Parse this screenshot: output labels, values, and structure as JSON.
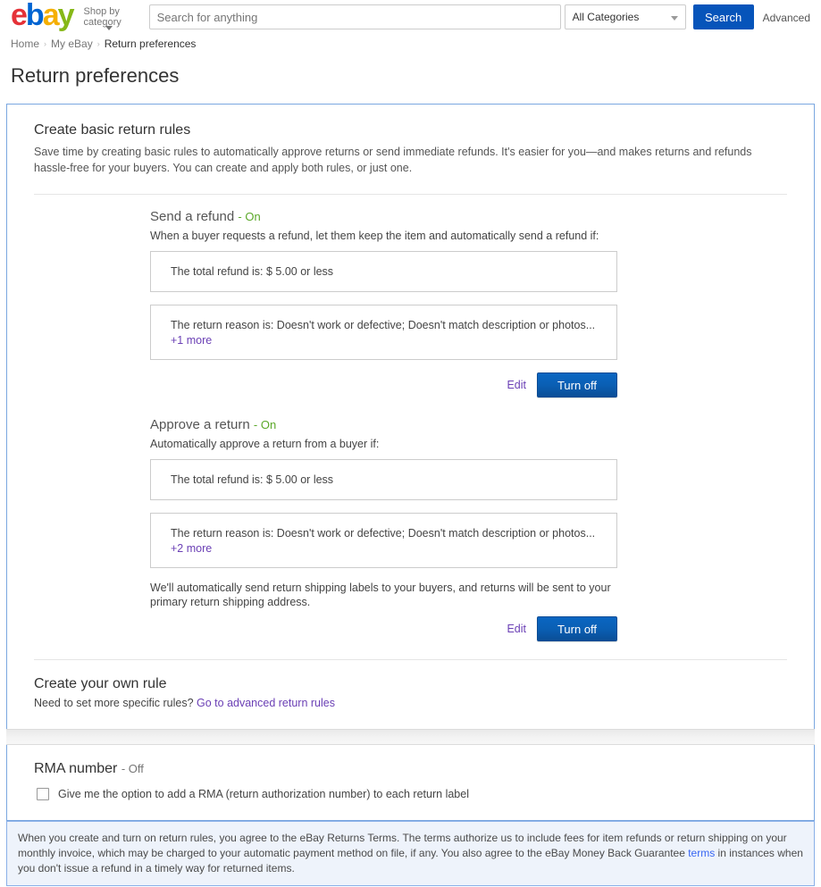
{
  "header": {
    "logo": {
      "e": "e",
      "b": "b",
      "a": "a",
      "y": "y",
      "alt": "ebay"
    },
    "shop_by_category": "Shop by category",
    "search_placeholder": "Search for anything",
    "search_value": "",
    "category_selected": "All Categories",
    "search_button": "Search",
    "advanced_link": "Advanced",
    "accent_blue": "#0654ba"
  },
  "breadcrumb": {
    "home": "Home",
    "my_ebay": "My eBay",
    "current": "Return preferences",
    "separator": "›"
  },
  "page_title": "Return preferences",
  "basic_rules": {
    "title": "Create basic return rules",
    "description": "Save time by creating basic rules to automatically approve returns or send immediate refunds. It's easier for you—and makes returns and refunds hassle-free for your buyers. You can create and apply both rules, or just one.",
    "rules": [
      {
        "name": "Send a refund",
        "state_prefix": "-",
        "state": "On",
        "state_color": "#5ba829",
        "subtitle": "When a buyer requests a refund, let them keep the item and automatically send a refund if:",
        "condition_amount": "The total refund is: $ 5.00 or less",
        "condition_reason_prefix": "The return reason is:  Doesn't work or defective; Doesn't match description or photos...",
        "condition_reason_more": "+1 more",
        "note": "",
        "edit_label": "Edit",
        "toggle_label": "Turn off"
      },
      {
        "name": "Approve a return",
        "state_prefix": "-",
        "state": "On",
        "state_color": "#5ba829",
        "subtitle": "Automatically approve a return from a buyer if:",
        "condition_amount": "The total refund is: $ 5.00 or less",
        "condition_reason_prefix": "The return reason is:  Doesn't work or defective; Doesn't match description or photos...",
        "condition_reason_more": "+2 more",
        "note": "We'll automatically send return shipping labels to your buyers, and returns will be sent to your primary return shipping address.",
        "edit_label": "Edit",
        "toggle_label": "Turn off"
      }
    ]
  },
  "own_rule": {
    "title": "Create your own rule",
    "text": "Need to set more specific rules? ",
    "link": "Go to advanced return rules"
  },
  "rma": {
    "title": "RMA number",
    "state_prefix": "-",
    "state": "Off",
    "checkbox_checked": false,
    "checkbox_label": "Give me the option to add a RMA (return authorization number) to each return label"
  },
  "footer": {
    "text_part1": "When you create and turn on return rules, you agree to the eBay Returns Terms. The terms authorize us to include fees for item refunds or return shipping on your monthly invoice, which may be charged to your automatic payment method on file, if any. You also agree to the eBay Money Back Guarantee ",
    "link": "terms",
    "text_part2": " in instances when you don't issue a refund in a timely way for returned items."
  }
}
